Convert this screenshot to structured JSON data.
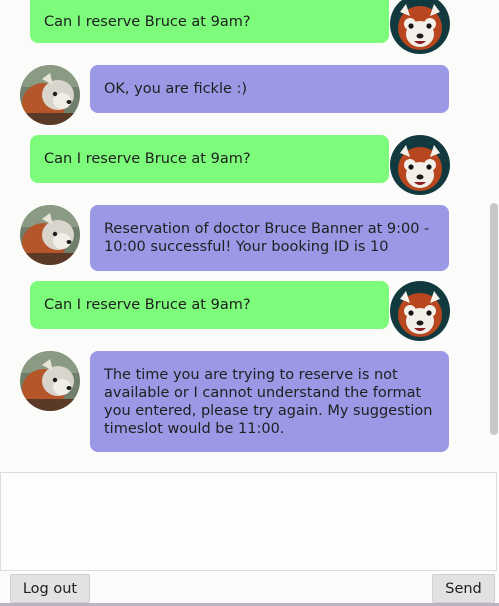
{
  "messages": [
    {
      "sender": "user",
      "text": "Can I reserve Bruce at 9am?"
    },
    {
      "sender": "bot",
      "text": "OK, you are fickle :)"
    },
    {
      "sender": "user",
      "text": "Can I reserve Bruce at 9am?"
    },
    {
      "sender": "bot",
      "text": "Reservation of doctor Bruce Banner at 9:00 - 10:00 successful! Your booking ID is 10"
    },
    {
      "sender": "user",
      "text": "Can I reserve Bruce at 9am?"
    },
    {
      "sender": "bot",
      "text": "The time you are trying to reserve is not available or I cannot understand the format you entered, please try again. My suggestion timeslot would be 11:00."
    }
  ],
  "composer": {
    "value": ""
  },
  "buttons": {
    "logout_label": "Log out",
    "send_label": "Send"
  },
  "avatars": {
    "user": "red-panda-front-icon",
    "bot": "red-panda-side-icon"
  },
  "colors": {
    "user_bubble": "#7cfc7a",
    "bot_bubble": "#9b99e6"
  }
}
